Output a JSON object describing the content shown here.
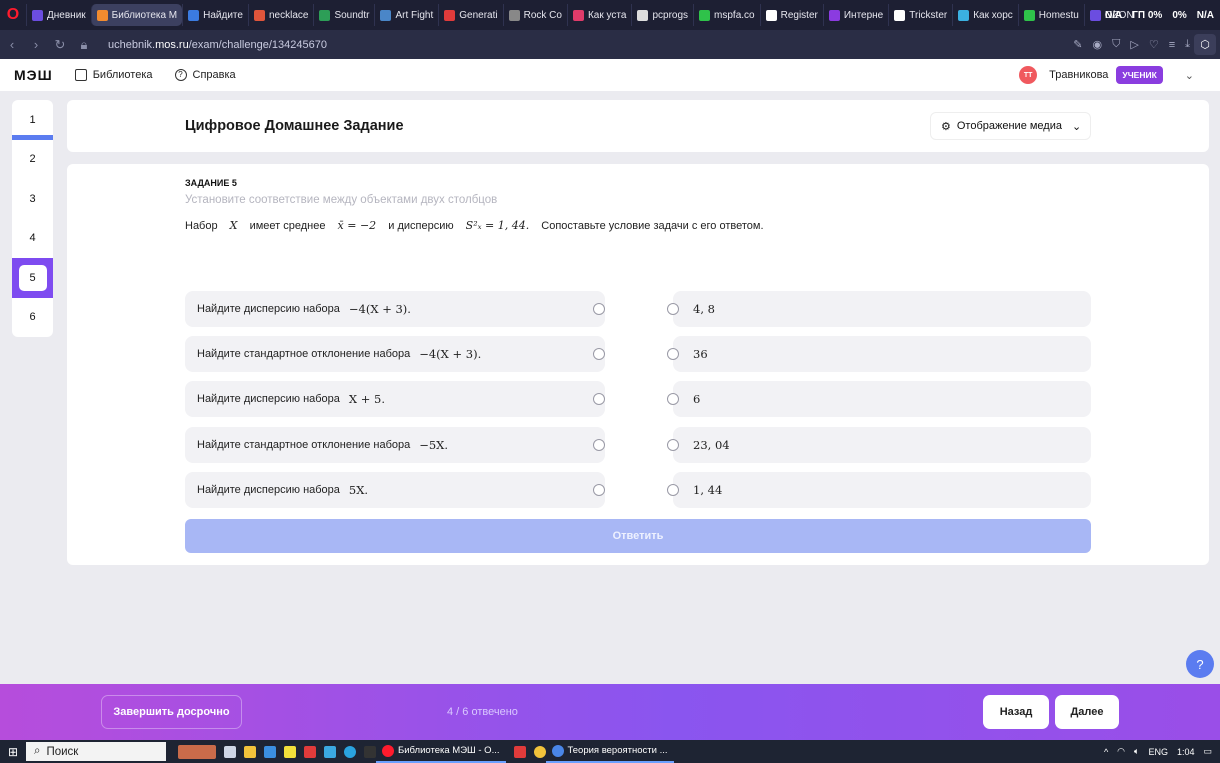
{
  "browser": {
    "tabs": [
      {
        "label": "Дневник",
        "color": "#6b4de0",
        "active": false
      },
      {
        "label": "Библиотека М",
        "color": "#f28b2f",
        "active": true
      },
      {
        "label": "Найдите",
        "color": "#3b7be0",
        "active": false
      },
      {
        "label": "necklace",
        "color": "#e0553b",
        "active": false
      },
      {
        "label": "Soundtr",
        "color": "#2d9e57",
        "active": false
      },
      {
        "label": "Art Fight",
        "color": "#4a86c8",
        "active": false
      },
      {
        "label": "Generati",
        "color": "#e03b3b",
        "active": false
      },
      {
        "label": "Rock Co",
        "color": "#888888",
        "active": false
      },
      {
        "label": "Как уста",
        "color": "#e03b6a",
        "active": false
      },
      {
        "label": "pcprogs",
        "color": "#dddddd",
        "active": false
      },
      {
        "label": "mspfa.co",
        "color": "#2fc24a",
        "active": false
      },
      {
        "label": "Register",
        "color": "#ffffff",
        "active": false
      },
      {
        "label": "Интерне",
        "color": "#8b3be0",
        "active": false
      },
      {
        "label": "Trickster",
        "color": "#ffffff",
        "active": false
      },
      {
        "label": "Как хорс",
        "color": "#3bb0e0",
        "active": false
      },
      {
        "label": "Homestu",
        "color": "#2fc24a",
        "active": false
      },
      {
        "label": "OZON",
        "color": "#6b4de0",
        "active": false
      }
    ],
    "right_text": [
      "N/A",
      "ГП 0%",
      "0%",
      "N/A"
    ],
    "url_prefix": "uchebnik.",
    "url_host": "mos.ru",
    "url_path": "/exam/challenge/134245670"
  },
  "header": {
    "logo": "МЭШ",
    "library_label": "Библиотека",
    "help_label": "Справка",
    "avatar_initials": "ТТ",
    "user_name": "Травникова",
    "role": "УЧЕНИК"
  },
  "nav": {
    "questions": [
      "1",
      "2",
      "3",
      "4",
      "5",
      "6"
    ],
    "active_index": 4,
    "answered": [
      1,
      2,
      3,
      4
    ]
  },
  "title": {
    "text": "Цифровое Домашнее Задание",
    "media_label": "Отображение медиа"
  },
  "task": {
    "label": "ЗАДАНИЕ 5",
    "instruction": "Установите соответствие между объектами двух столбцов",
    "text_1": "Набор",
    "math_X": "X",
    "text_2": "имеет среднее",
    "math_mean": "x̄ = −2",
    "text_3": "и дисперсию",
    "math_var": "S²ₓ = 1, 44.",
    "text_4": "Сопоставьте условие задачи с его ответом."
  },
  "left_items": [
    {
      "text": "Найдите дисперсию набора",
      "math": "−4(X + 3)."
    },
    {
      "text": "Найдите стандартное отклонение набора",
      "math": "−4(X + 3)."
    },
    {
      "text": "Найдите дисперсию набора",
      "math": "X + 5."
    },
    {
      "text": "Найдите стандартное отклонение  набора",
      "math": "−5X."
    },
    {
      "text": "Найдите дисперсию набора",
      "math": "5X."
    }
  ],
  "right_items": [
    "4, 8",
    "36",
    "6",
    "23, 04",
    "1, 44"
  ],
  "answer_label": "Ответить",
  "help_label": "?",
  "bottom": {
    "finish_label": "Завершить досрочно",
    "progress": "4 / 6 отвечено",
    "back_label": "Назад",
    "next_label": "Далее"
  },
  "taskbar": {
    "search_label": "Поиск",
    "apps": [
      "Библиотека МЭШ - О...",
      "Теория вероятности ..."
    ],
    "lang": "ENG",
    "time": "1:04"
  }
}
